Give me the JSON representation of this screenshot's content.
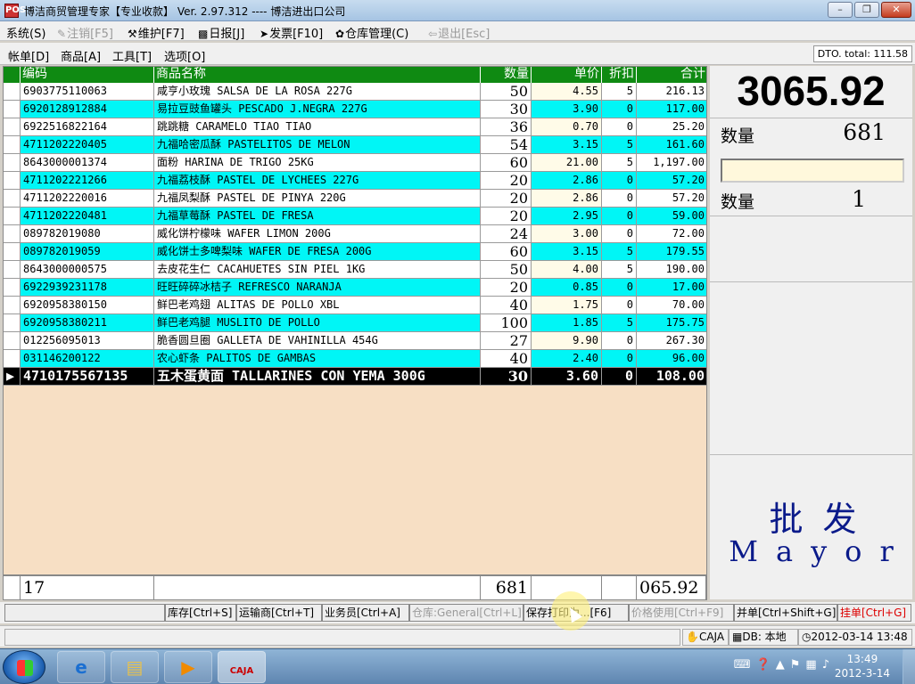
{
  "window": {
    "title": "博洁商贸管理专家【专业收款】 Ver. 2.97.312 ---- 博洁进出口公司",
    "app_icon": "POS"
  },
  "menu": {
    "system": "系统(S)",
    "logout": "注销[F5]",
    "maintain": "维护[F7]",
    "daily_report": "日报[J]",
    "invoice": "发票[F10]",
    "warehouse": "仓库管理(C)",
    "exit": "退出[Esc]"
  },
  "submenu": {
    "account": "帐单[D]",
    "goods": "商品[A]",
    "tools": "工具[T]",
    "options": "选项[O]"
  },
  "dto_total": "DTO. total: 111.58",
  "grid": {
    "headers": {
      "code": "编码",
      "name": "商品名称",
      "qty": "数量",
      "price": "单价",
      "discount": "折扣",
      "total": "合计"
    },
    "rows": [
      {
        "code": "6903775110063",
        "name": "咸亨小玫瑰 SALSA DE LA ROSA 227G",
        "qty": "50",
        "price": "4.55",
        "discount": "5",
        "total": "216.13"
      },
      {
        "code": "6920128912884",
        "name": "易拉豆豉鱼罐头 PESCADO J.NEGRA 227G",
        "qty": "30",
        "price": "3.90",
        "discount": "0",
        "total": "117.00"
      },
      {
        "code": "6922516822164",
        "name": "跳跳糖 CARAMELO TIAO TIAO",
        "qty": "36",
        "price": "0.70",
        "discount": "0",
        "total": "25.20"
      },
      {
        "code": "4711202220405",
        "name": "九福哈密瓜酥 PASTELITOS DE MELON",
        "qty": "54",
        "price": "3.15",
        "discount": "5",
        "total": "161.60"
      },
      {
        "code": "8643000001374",
        "name": "面粉 HARINA DE TRIGO 25KG",
        "qty": "60",
        "price": "21.00",
        "discount": "5",
        "total": "1,197.00"
      },
      {
        "code": "4711202221266",
        "name": "九福荔枝酥 PASTEL DE LYCHEES 227G",
        "qty": "20",
        "price": "2.86",
        "discount": "0",
        "total": "57.20"
      },
      {
        "code": "4711202220016",
        "name": "九福凤梨酥 PASTEL DE PINYA 220G",
        "qty": "20",
        "price": "2.86",
        "discount": "0",
        "total": "57.20"
      },
      {
        "code": "4711202220481",
        "name": "九福草莓酥 PASTEL DE FRESA",
        "qty": "20",
        "price": "2.95",
        "discount": "0",
        "total": "59.00"
      },
      {
        "code": "089782019080",
        "name": "威化饼柠檬味 WAFER LIMON 200G",
        "qty": "24",
        "price": "3.00",
        "discount": "0",
        "total": "72.00"
      },
      {
        "code": "089782019059",
        "name": "威化饼士多啤梨味 WAFER DE FRESA 200G",
        "qty": "60",
        "price": "3.15",
        "discount": "5",
        "total": "179.55"
      },
      {
        "code": "8643000000575",
        "name": "去皮花生仁 CACAHUETES SIN PIEL 1KG",
        "qty": "50",
        "price": "4.00",
        "discount": "5",
        "total": "190.00"
      },
      {
        "code": "6922939231178",
        "name": "旺旺碎碎冰桔子 REFRESCO NARANJA",
        "qty": "20",
        "price": "0.85",
        "discount": "0",
        "total": "17.00"
      },
      {
        "code": "6920958380150",
        "name": "鲜巴老鸡翅 ALITAS DE POLLO XBL",
        "qty": "40",
        "price": "1.75",
        "discount": "0",
        "total": "70.00"
      },
      {
        "code": "6920958380211",
        "name": "鲜巴老鸡腿 MUSLITO DE POLLO",
        "qty": "100",
        "price": "1.85",
        "discount": "5",
        "total": "175.75"
      },
      {
        "code": "012256095013",
        "name": "脆香圆旦圈 GALLETA DE VAHINILLA 454G",
        "qty": "27",
        "price": "9.90",
        "discount": "0",
        "total": "267.30"
      },
      {
        "code": "031146200122",
        "name": "农心虾条 PALITOS DE GAMBAS",
        "qty": "40",
        "price": "2.40",
        "discount": "0",
        "total": "96.00"
      },
      {
        "code": "4710175567135",
        "name": "五木蛋黄面 TALLARINES CON YEMA 300G",
        "qty": "30",
        "price": "3.60",
        "discount": "0",
        "total": "108.00",
        "selected": true
      }
    ],
    "footer": {
      "count": "17",
      "qty_sum": "681",
      "total_sum": "065.92"
    }
  },
  "right_panel": {
    "grand_total": "3065.92",
    "qty_label": "数量",
    "qty_value": "681",
    "input_value": "",
    "qty2_label": "数量",
    "qty2_value": "1",
    "mode_cn": "批发",
    "mode_es": "Mayor"
  },
  "buttons": {
    "stock": "库存[Ctrl+S]",
    "carrier": "运输商[Ctrl+T]",
    "salesman": "业务员[Ctrl+A]",
    "warehouse": "仓库:General[Ctrl+L]",
    "save_print": "保存打印为...[F6]",
    "price_use": "价格使用[Ctrl+F9]",
    "merge": "并单[Ctrl+Shift+G]",
    "hang": "挂单[Ctrl+G]"
  },
  "status": {
    "user": "CAJA",
    "db": "DB: 本地",
    "datetime": "2012-03-14 13:48"
  },
  "taskbar": {
    "time": "13:49",
    "date": "2012-3-14",
    "active_app_label": "CAJA"
  },
  "colors": {
    "header_green": "#0f8a12",
    "cyan_row": "#00f6f6",
    "grid_bg": "#f7dfc4",
    "mode_blue": "#0a1a8a",
    "hang_red": "#dd0000"
  }
}
